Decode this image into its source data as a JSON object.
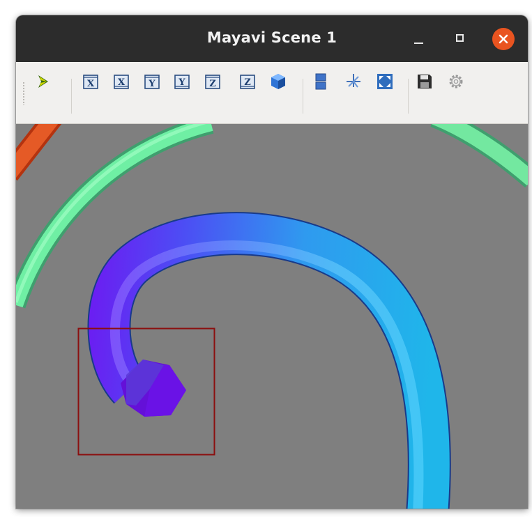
{
  "window": {
    "title": "Mayavi Scene 1",
    "controls": {
      "minimize_icon": "minimize-icon",
      "maximize_icon": "maximize-icon",
      "close_icon": "close-icon",
      "close_color": "#e95420"
    }
  },
  "toolbar": {
    "buttons": [
      {
        "name": "mayavi-pipeline-button",
        "icon": "mayavi-icon"
      },
      {
        "name": "view-x-positive-button",
        "icon": "x-axis-icon",
        "glyph": "X"
      },
      {
        "name": "view-x-negative-button",
        "icon": "x-axis-icon",
        "glyph": "X"
      },
      {
        "name": "view-y-positive-button",
        "icon": "y-axis-icon",
        "glyph": "Y"
      },
      {
        "name": "view-y-negative-button",
        "icon": "y-axis-icon",
        "glyph": "Y"
      },
      {
        "name": "view-z-positive-button",
        "icon": "z-axis-icon",
        "glyph": "Z"
      },
      {
        "name": "view-z-negative-button",
        "icon": "z-axis-icon",
        "glyph": "Z"
      },
      {
        "name": "isometric-view-button",
        "icon": "cube-icon"
      },
      {
        "name": "parallel-projection-button",
        "icon": "parallel-projection-icon"
      },
      {
        "name": "toggle-axes-button",
        "icon": "axes-icon"
      },
      {
        "name": "full-screen-button",
        "icon": "fullscreen-icon"
      },
      {
        "name": "save-scene-button",
        "icon": "save-icon"
      },
      {
        "name": "configure-scene-button",
        "icon": "gear-icon"
      }
    ]
  },
  "scene": {
    "background_color": "#7f7f7f",
    "selection_box_color": "#8b0f0f"
  }
}
